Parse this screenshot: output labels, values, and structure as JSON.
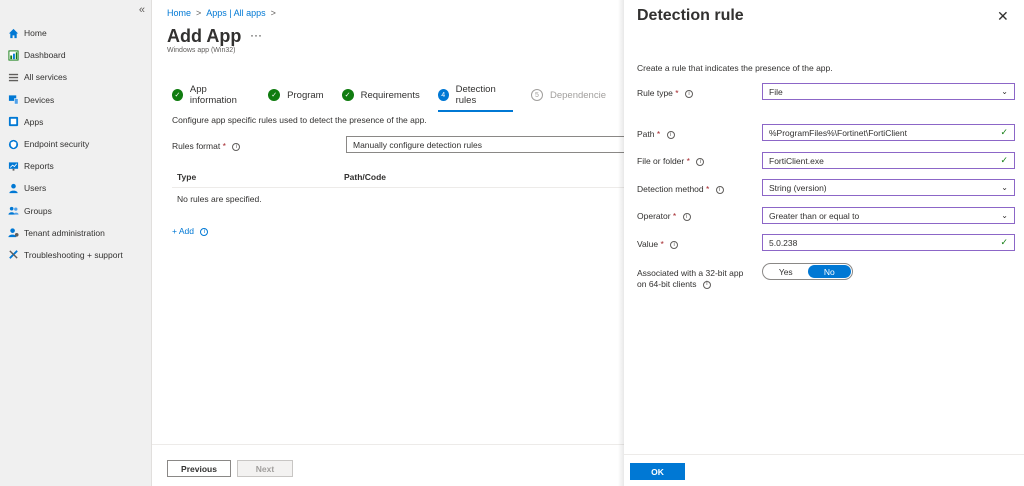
{
  "sidebar": {
    "collapse_glyph": "«",
    "items": [
      {
        "label": "Home",
        "icon": "home-icon"
      },
      {
        "label": "Dashboard",
        "icon": "dashboard-icon"
      },
      {
        "label": "All services",
        "icon": "all-services-icon"
      },
      {
        "label": "Devices",
        "icon": "devices-icon"
      },
      {
        "label": "Apps",
        "icon": "apps-icon"
      },
      {
        "label": "Endpoint security",
        "icon": "endpoint-security-icon"
      },
      {
        "label": "Reports",
        "icon": "reports-icon"
      },
      {
        "label": "Users",
        "icon": "users-icon"
      },
      {
        "label": "Groups",
        "icon": "groups-icon"
      },
      {
        "label": "Tenant administration",
        "icon": "tenant-admin-icon"
      },
      {
        "label": "Troubleshooting + support",
        "icon": "troubleshooting-icon"
      }
    ]
  },
  "main": {
    "breadcrumb": [
      "Home",
      "Apps | All apps"
    ],
    "title": "Add App",
    "title_more": "···",
    "subtitle": "Windows app (Win32)",
    "steps": [
      {
        "label": "App information",
        "state": "done",
        "marker": "✓"
      },
      {
        "label": "Program",
        "state": "done",
        "marker": "✓"
      },
      {
        "label": "Requirements",
        "state": "done",
        "marker": "✓"
      },
      {
        "label": "Detection rules",
        "state": "current",
        "marker": "4"
      },
      {
        "label": "Dependencie",
        "state": "pending",
        "marker": "5"
      }
    ],
    "description": "Configure app specific rules used to detect the presence of the app.",
    "rules_format_label": "Rules format",
    "rules_format_value": "Manually configure detection rules",
    "table": {
      "columns": [
        "Type",
        "Path/Code"
      ],
      "empty_text": "No rules are specified."
    },
    "add_label": "+ Add",
    "prev_label": "Previous",
    "next_label": "Next"
  },
  "panel": {
    "title": "Detection rule",
    "close_glyph": "✕",
    "description": "Create a rule that indicates the presence of the app.",
    "fields": {
      "rule_type": {
        "label": "Rule type",
        "value": "File"
      },
      "path": {
        "label": "Path",
        "value": "%ProgramFiles%\\Fortinet\\FortiClient"
      },
      "file_or_folder": {
        "label": "File or folder",
        "value": "FortiClient.exe"
      },
      "detection_method": {
        "label": "Detection method",
        "value": "String (version)"
      },
      "operator": {
        "label": "Operator",
        "value": "Greater than or equal to"
      },
      "value": {
        "label": "Value",
        "value": "5.0.238"
      }
    },
    "association": {
      "label_line1": "Associated with a 32-bit app",
      "label_line2": "on 64-bit clients",
      "options": [
        "Yes",
        "No"
      ],
      "selected": "No"
    },
    "ok_label": "OK"
  },
  "colors": {
    "accent": "#0078d4",
    "success": "#107c10",
    "required": "#a4262c",
    "focus_border": "#8c66c7"
  }
}
